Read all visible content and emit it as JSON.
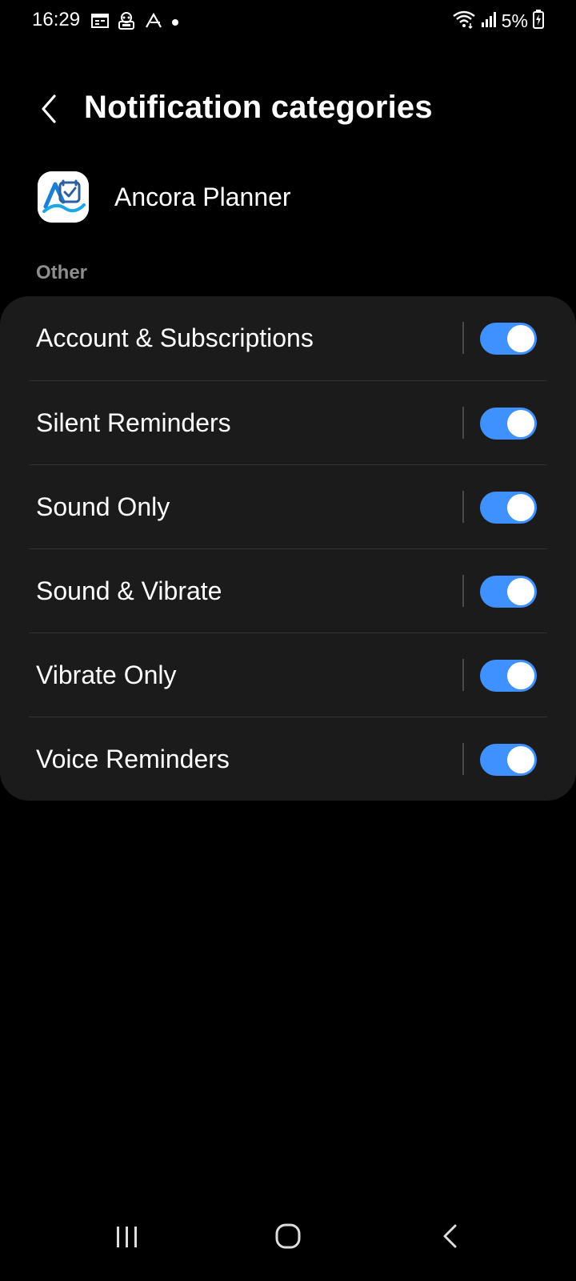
{
  "status_bar": {
    "time": "16:29",
    "battery": "5%",
    "icons": [
      "calendar-icon",
      "robot-icon",
      "arrow-app-icon",
      "dot-icon",
      "wifi-icon",
      "signal-icon",
      "battery-charging-icon"
    ]
  },
  "header": {
    "title": "Notification categories",
    "back_icon": "chevron-left-icon"
  },
  "app": {
    "name": "Ancora Planner",
    "icon": "ancora-planner-app-icon"
  },
  "section": {
    "label": "Other"
  },
  "categories": [
    {
      "label": "Account & Subscriptions",
      "enabled": true
    },
    {
      "label": "Silent Reminders",
      "enabled": true
    },
    {
      "label": "Sound Only",
      "enabled": true
    },
    {
      "label": "Sound & Vibrate",
      "enabled": true
    },
    {
      "label": "Vibrate Only",
      "enabled": true
    },
    {
      "label": "Voice Reminders",
      "enabled": true
    }
  ],
  "colors": {
    "background": "#000000",
    "card": "#1b1b1b",
    "toggle_on": "#3e91ff",
    "section_label": "#8e8e8e"
  },
  "nav_bar": {
    "icons": [
      "recents-icon",
      "home-icon",
      "back-icon"
    ]
  }
}
